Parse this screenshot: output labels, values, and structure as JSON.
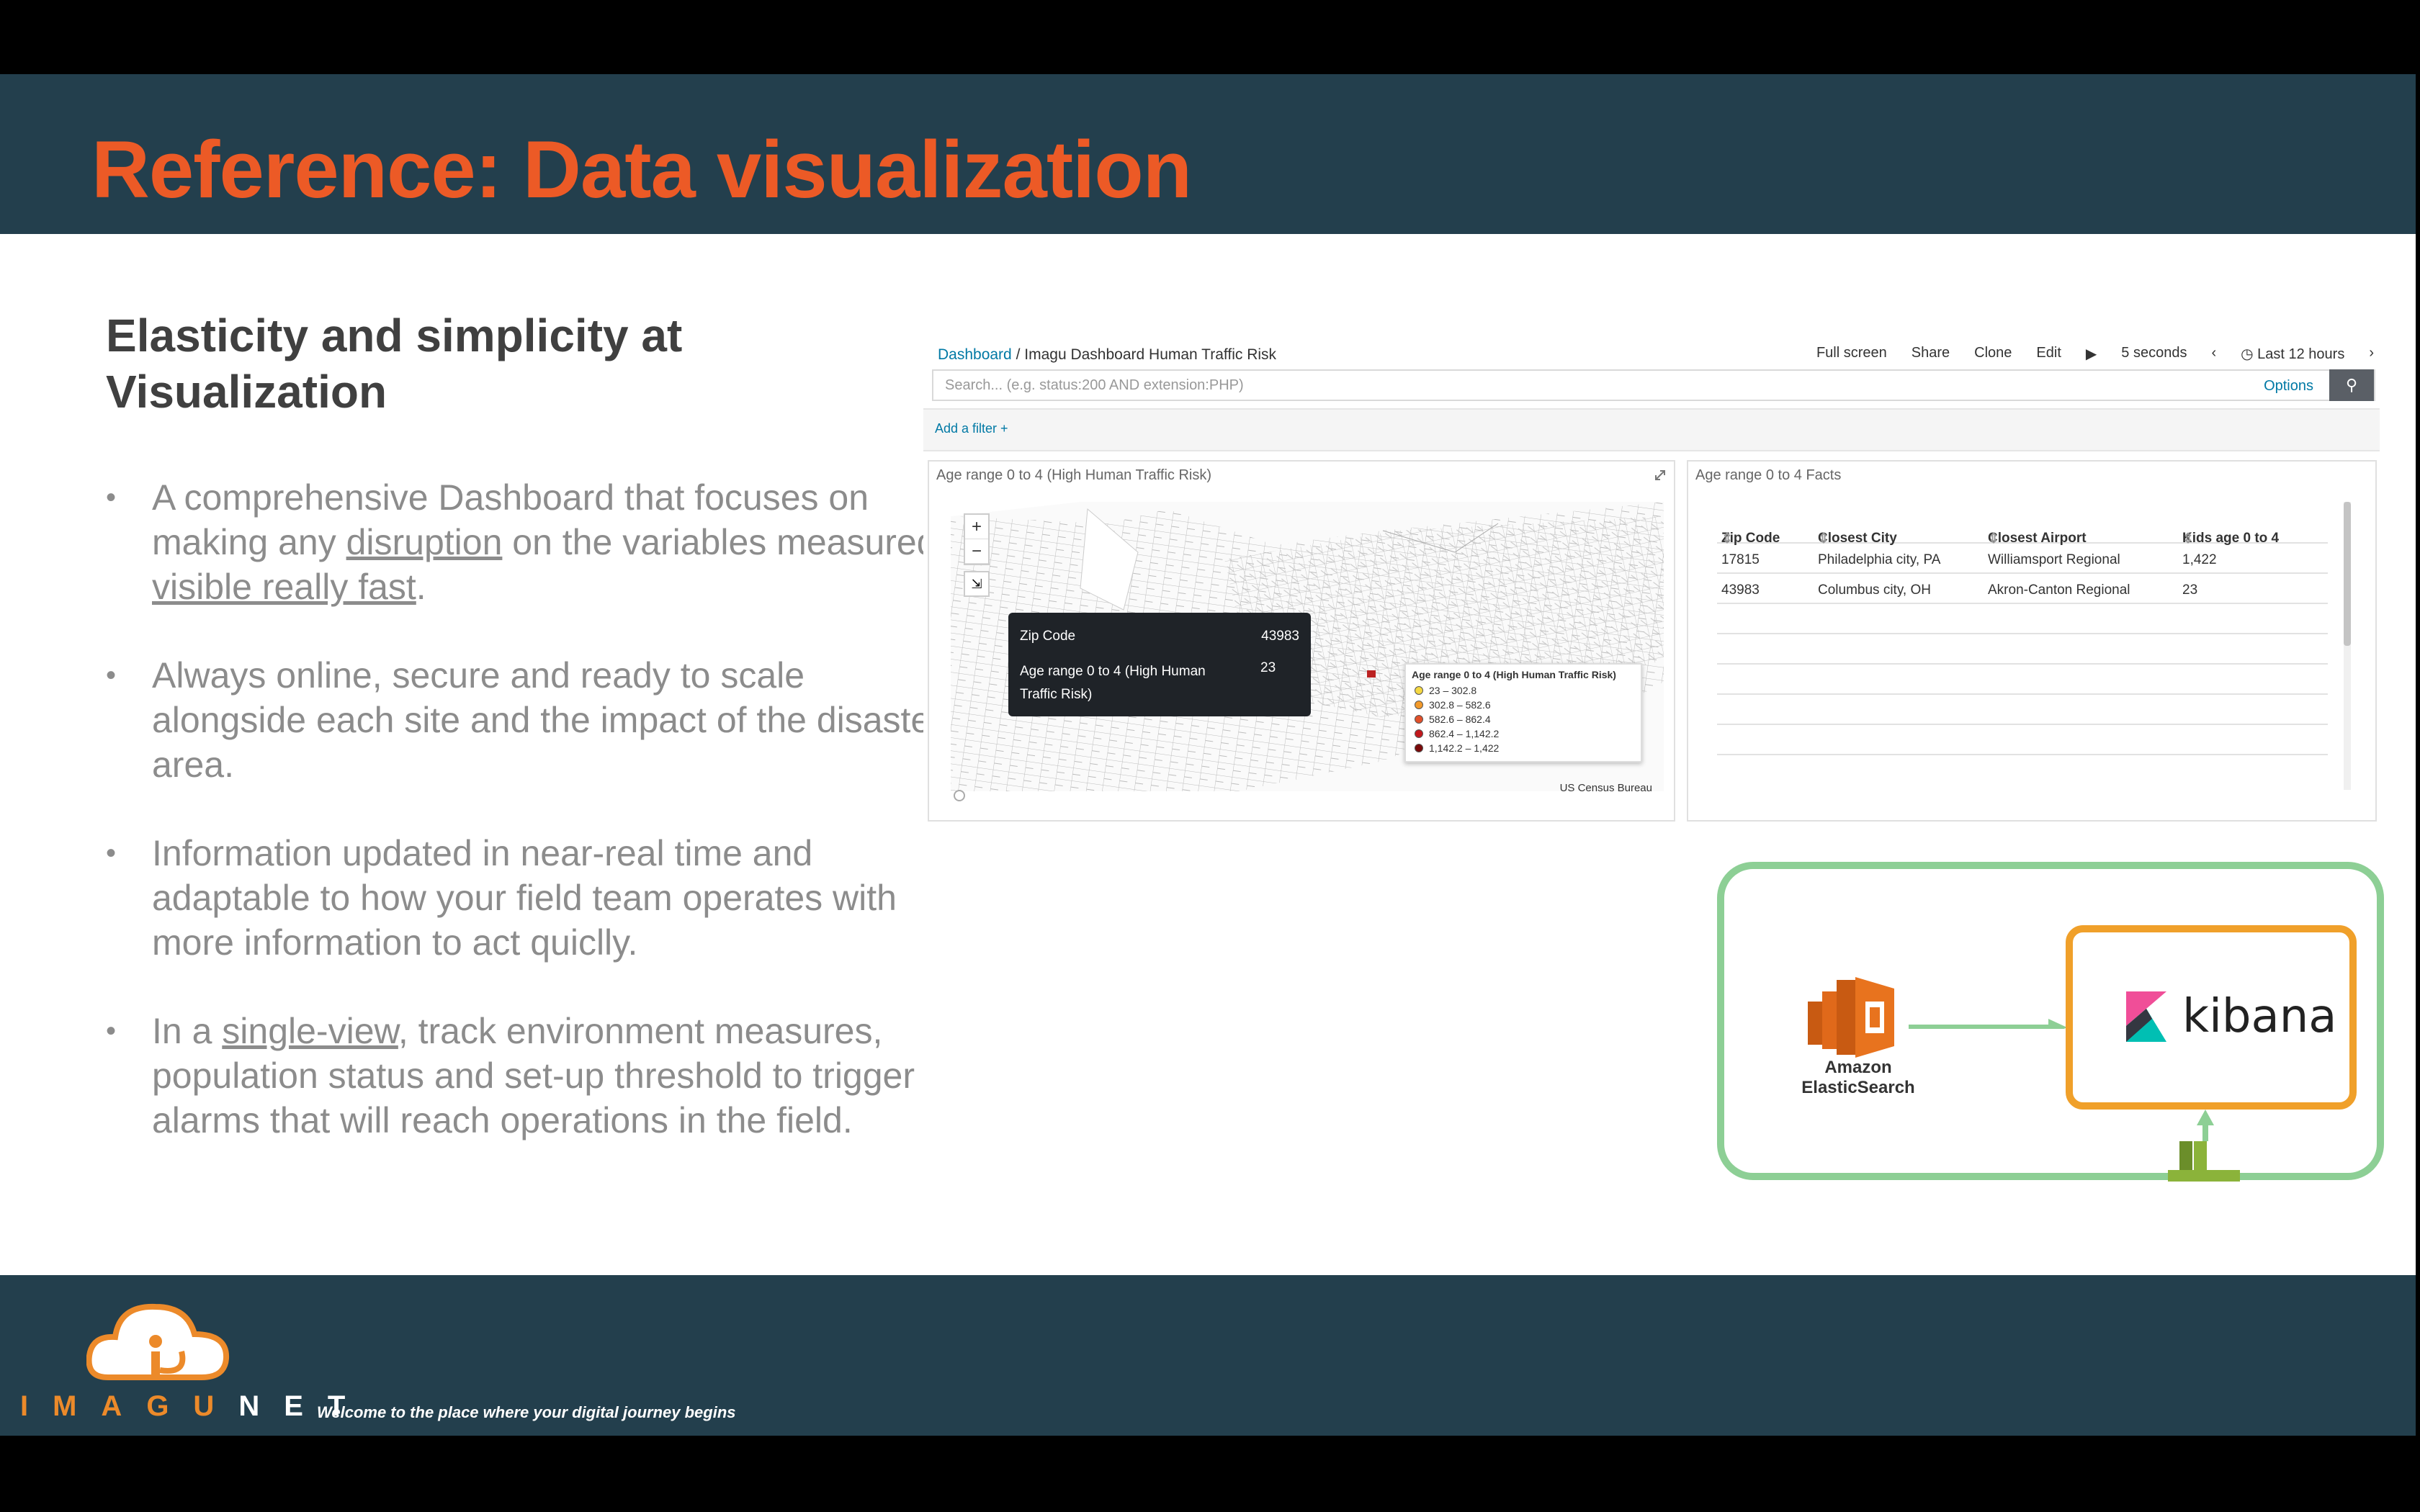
{
  "slide": {
    "title": "Reference: Data visualization",
    "subtitle": "Elasticity and simplicity at Visualization",
    "bullets": {
      "b1_pre": "A comprehensive Dashboard that focuses on making any ",
      "b1_link1": "disruption",
      "b1_mid": " on the variables measured, ",
      "b1_link2": "visible really fast",
      "b1_post": ".",
      "b2": "Always online, secure and ready to scale alongside each site and the impact of the disaster area.",
      "b3": "Information updated in near-real time and adaptable to how your field team operates with more information to act quiclly.",
      "b4_pre": "In a ",
      "b4_link": "single-view",
      "b4_post": ", track environment measures, population status and set-up threshold to trigger alarms that will reach operations in the field."
    }
  },
  "kibana": {
    "breadcrumb_root": "Dashboard",
    "breadcrumb_sep": "/",
    "breadcrumb_current": "Imagu Dashboard Human Traffic Risk",
    "toolbar": {
      "full_screen": "Full screen",
      "share": "Share",
      "clone": "Clone",
      "edit": "Edit",
      "play": "▶",
      "interval": "5 seconds",
      "prev": "‹",
      "time_range": "Last 12 hours",
      "next": "›"
    },
    "search_placeholder": "Search... (e.g. status:200 AND extension:PHP)",
    "options_label": "Options",
    "add_filter": "Add a filter +",
    "map_panel": {
      "title": "Age range 0 to 4 (High Human Traffic Risk)",
      "zoom_in": "+",
      "zoom_out": "−",
      "tooltip": {
        "label1": "Zip Code",
        "value1": "43983",
        "label2": "Age range 0 to 4 (High Human Traffic Risk)",
        "value2": "23"
      },
      "legend_title": "Age range 0 to 4 (High Human Traffic Risk)",
      "legend": [
        {
          "range": "23 – 302.8",
          "color": "#f5d842"
        },
        {
          "range": "302.8 – 582.6",
          "color": "#f39a2a"
        },
        {
          "range": "582.6 – 862.4",
          "color": "#e2502a"
        },
        {
          "range": "862.4 – 1,142.2",
          "color": "#c2181d"
        },
        {
          "range": "1,142.2 – 1,422",
          "color": "#7a0a0a"
        }
      ],
      "attribution": "US Census Bureau"
    },
    "facts_panel": {
      "title": "Age range 0 to 4 Facts",
      "columns": [
        "Zip Code",
        "Closest City",
        "Closest Airport",
        "Kids age 0 to 4"
      ],
      "rows": [
        [
          "17815",
          "Philadelphia city, PA",
          "Williamsport Regional",
          "1,422"
        ],
        [
          "43983",
          "Columbus city, OH",
          "Akron-Canton Regional",
          "23"
        ]
      ]
    }
  },
  "diagram": {
    "es_label": "Amazon ElasticSearch",
    "kibana_word": "kibana",
    "colors": {
      "outer": "#8dcf95",
      "kibana_box": "#f0a02a",
      "es": "#e8731e",
      "cloudwatch": "#6b8e2a"
    }
  },
  "footer": {
    "brand_orange": "IMAGU",
    "brand_white": "NET",
    "tagline": "Welcome to the place where your digital journey begins"
  },
  "colors": {
    "header_bg": "#233f4d",
    "title": "#ec5a26"
  }
}
